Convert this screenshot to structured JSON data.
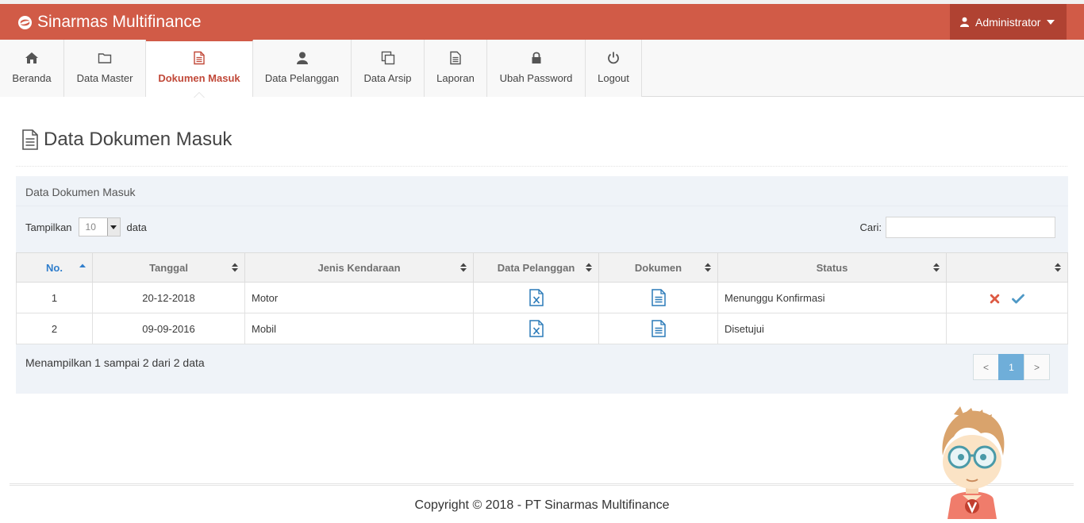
{
  "navbar": {
    "brand": "Sinarmas Multifinance",
    "user": "Administrator",
    "color": "#d15b47"
  },
  "menu": [
    {
      "label": "Beranda",
      "icon": "home-icon"
    },
    {
      "label": "Data Master",
      "icon": "folder-icon"
    },
    {
      "label": "Dokumen Masuk",
      "icon": "file-text-icon",
      "active": true
    },
    {
      "label": "Data Pelanggan",
      "icon": "user-icon"
    },
    {
      "label": "Data Arsip",
      "icon": "copy-icon"
    },
    {
      "label": "Laporan",
      "icon": "file-icon"
    },
    {
      "label": "Ubah Password",
      "icon": "lock-icon"
    },
    {
      "label": "Logout",
      "icon": "power-icon"
    }
  ],
  "page": {
    "title": "Data Dokumen Masuk"
  },
  "widget": {
    "title": "Data Dokumen Masuk",
    "length_prefix": "Tampilkan",
    "length_value": "10",
    "length_suffix": "data",
    "search_label": "Cari:",
    "search_value": ""
  },
  "table": {
    "headers": [
      "No.",
      "Tanggal",
      "Jenis Kendaraan",
      "Data Pelanggan",
      "Dokumen",
      "Status",
      ""
    ],
    "rows": [
      {
        "no": "1",
        "tanggal": "20-12-2018",
        "jenis": "Motor",
        "status": "Menunggu Konfirmasi",
        "actions": true
      },
      {
        "no": "2",
        "tanggal": "09-09-2016",
        "jenis": "Mobil",
        "status": "Disetujui",
        "actions": false
      }
    ]
  },
  "info": "Menampilkan 1 sampai 2 dari 2 data",
  "pager": {
    "prev": "<",
    "current": "1",
    "next": ">"
  },
  "footer": "Copyright © 2018 - PT Sinarmas Multifinance"
}
